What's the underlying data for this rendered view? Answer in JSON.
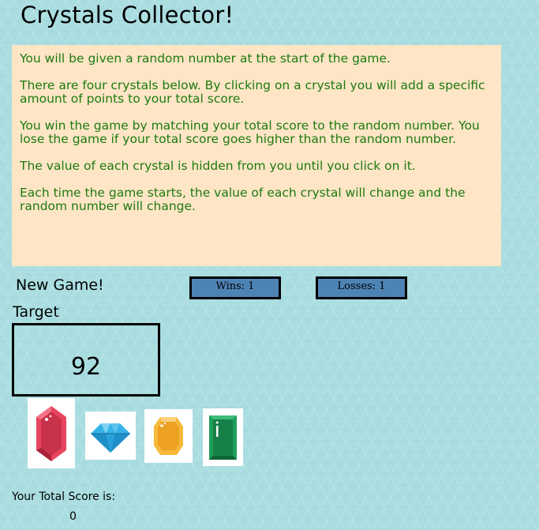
{
  "title": "Crystals Collector!",
  "instructions": [
    "You will be given a random number at the start of the game.",
    "There are four crystals below. By clicking on a crystal you will add a specific amount of points to your total score.",
    "You win the game by matching your total score to the random number. You lose the game if your total score goes higher than the random number.",
    "The value of each crystal is hidden from you until you click on it.",
    "Each time the game starts, the value of each crystal will change and the random number will change."
  ],
  "new_game_label": "New Game!",
  "wins_text": "Wins: 1",
  "losses_text": "Losses: 1",
  "target_label": "Target",
  "target_value": "92",
  "crystals": [
    {
      "icon": "red-crystal-icon",
      "color": "#e8455e"
    },
    {
      "icon": "blue-diamond-icon",
      "color": "#35b2e6"
    },
    {
      "icon": "yellow-crystal-icon",
      "color": "#f6b93b"
    },
    {
      "icon": "green-emerald-icon",
      "color": "#1e9e5a"
    }
  ],
  "score_label": "Your Total Score is:",
  "score_value": "0",
  "colors": {
    "background": "#a9dde0",
    "instructions_bg": "#fde5c5",
    "instructions_text": "#1d7a10",
    "counter_bg": "#4e83b5"
  }
}
